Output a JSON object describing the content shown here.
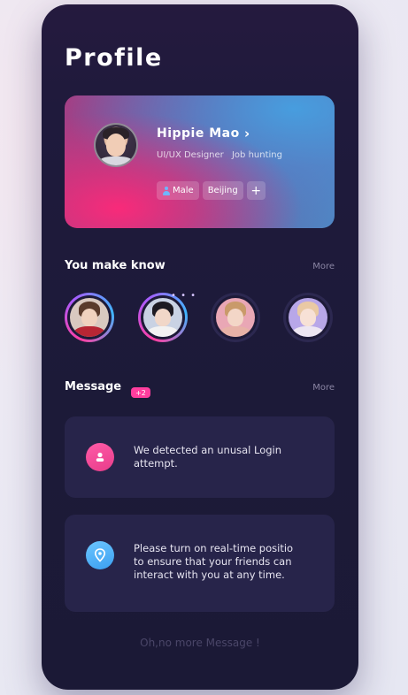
{
  "page": {
    "title": "Profile"
  },
  "profile": {
    "name": "Hippie Mao",
    "role": "UI/UX Designer",
    "status": "Job hunting",
    "tags": {
      "gender": "Male",
      "city": "Beijing",
      "add": "+"
    }
  },
  "people_section": {
    "title": "You make know",
    "more": "More",
    "people": [
      {
        "ring": "gradient",
        "skin": "#f0d2bf",
        "hair": "#5a3b2c",
        "body": "#b82634"
      },
      {
        "ring": "gradient",
        "skin": "#f1d7c8",
        "hair": "#1d1a22",
        "body": "#f2f2f2"
      },
      {
        "ring": "dim",
        "skin": "#f3d6c7",
        "hair": "#c99a6a",
        "body": "#e7b2a7"
      },
      {
        "ring": "dim",
        "skin": "#f7e1d6",
        "hair": "#e9c9a4",
        "body": "#ede6f2"
      }
    ],
    "more_dots": "• • •"
  },
  "message_section": {
    "title": "Message",
    "badge": "+2",
    "more": "More",
    "messages": [
      {
        "icon": "user-icon",
        "text_line1": "We detected an unusal Login",
        "text_line2": "attempt.",
        "text_line3": ""
      },
      {
        "icon": "location-pin-icon",
        "text_line1": "Please turn on real-time positio",
        "text_line2": "to ensure that your friends can",
        "text_line3": "interact with you at any time."
      }
    ],
    "footer": "Oh,no more Message !"
  },
  "colors": {
    "accent_pink": "#ff3e9e",
    "accent_blue": "#3fb6ff",
    "background": "#1c1a38"
  }
}
